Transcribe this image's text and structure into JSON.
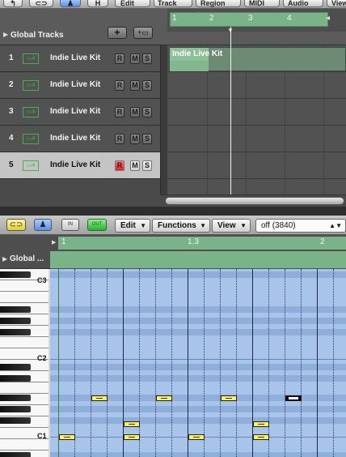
{
  "arrange": {
    "toolbar": {
      "menus": [
        {
          "label": "Edit"
        },
        {
          "label": "Track"
        },
        {
          "label": "Region"
        },
        {
          "label": "MIDI"
        },
        {
          "label": "Audio"
        },
        {
          "label": "View"
        }
      ],
      "h_button": "H"
    },
    "global_tracks_label": "Global Tracks",
    "add_button": "+",
    "ruler": [
      "1",
      "2",
      "3",
      "4"
    ],
    "tracks": [
      {
        "num": "1",
        "name": "Indie Live Kit",
        "r": "R",
        "m": "M",
        "s": "S"
      },
      {
        "num": "2",
        "name": "Indie Live Kit",
        "r": "R",
        "m": "M",
        "s": "S"
      },
      {
        "num": "3",
        "name": "Indie Live Kit",
        "r": "R",
        "m": "M",
        "s": "S"
      },
      {
        "num": "4",
        "name": "Indie Live Kit",
        "r": "R",
        "m": "M",
        "s": "S"
      },
      {
        "num": "5",
        "name": "Indie Live Kit",
        "r": "R",
        "m": "M",
        "s": "S"
      }
    ],
    "region_label": "Indie Live Kit",
    "track_icon": "drum-machine-icon",
    "selected_track": "5",
    "armed_track": "5"
  },
  "piano_roll": {
    "toolbar": {
      "edit_menu": "Edit",
      "functions_menu": "Functions",
      "view_menu": "View",
      "quantize_value": "off (3840)",
      "in_label": "IN",
      "out_label": "OUT"
    },
    "global_label": "Global ...",
    "ruler": [
      "1",
      "1.3",
      "2"
    ],
    "octave_labels": [
      "C3",
      "C2",
      "C1"
    ],
    "note_color": "#fff25a",
    "grid_color": "#9fbde6"
  }
}
